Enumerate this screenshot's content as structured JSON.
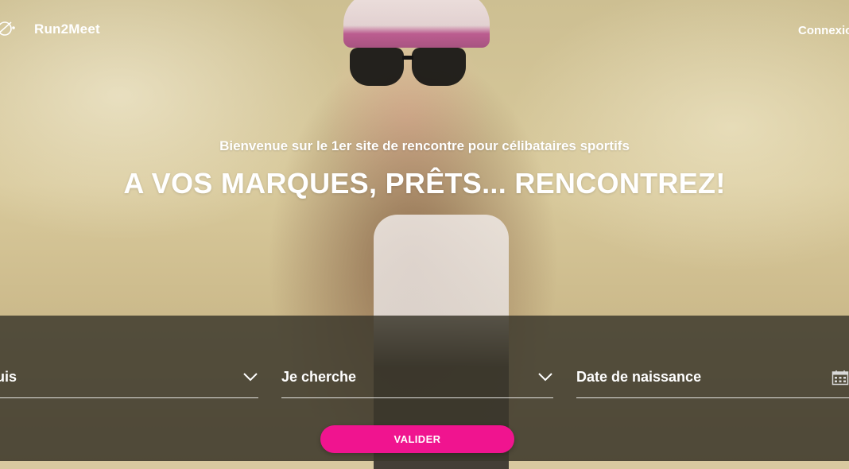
{
  "header": {
    "brand": "Run2Meet",
    "login_label": "Connexio",
    "logo_icon": "run2meet-logo-icon"
  },
  "hero": {
    "subtitle": "Bienvenue sur le 1er site de rencontre pour célibataires sportifs",
    "headline": "A VOS MARQUES, PRÊTS... RENCONTREZ!"
  },
  "form": {
    "i_am_label": "e suis",
    "looking_for_label": "Je cherche",
    "birthdate_label": "Date de naissance",
    "submit_label": "VALIDER",
    "dropdown_icon": "chevron-down-icon",
    "date_icon": "calendar-icon"
  },
  "colors": {
    "accent": "#f0148f",
    "band": "#3c382c",
    "text": "#ffffff"
  }
}
